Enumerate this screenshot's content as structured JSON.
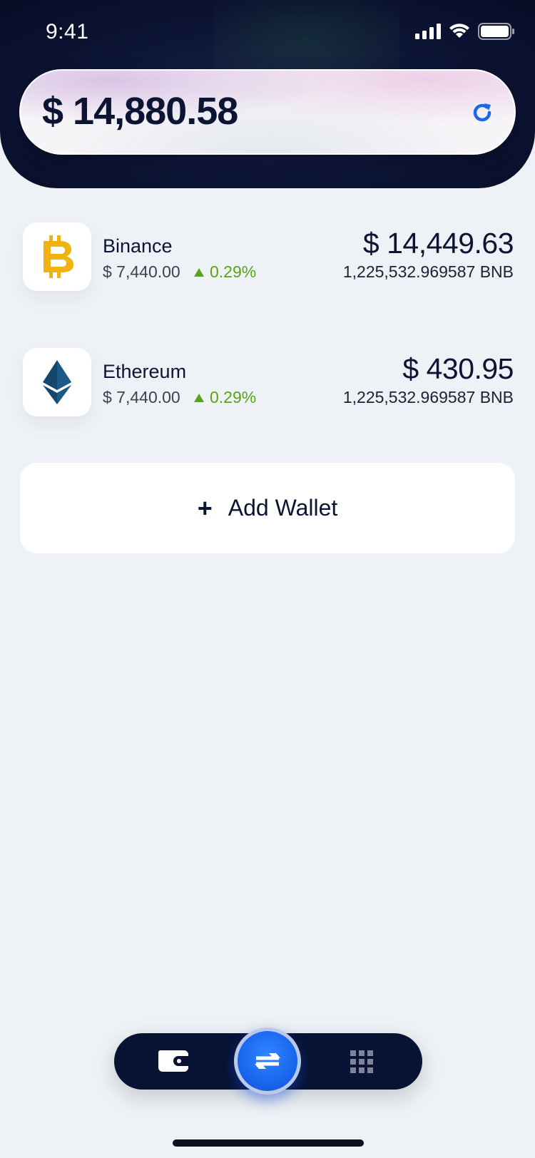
{
  "status_bar": {
    "time": "9:41"
  },
  "balance": {
    "total": "$ 14,880.58"
  },
  "wallets": [
    {
      "name": "Binance",
      "price": "$ 7,440.00",
      "change": "0.29%",
      "value": "$ 14,449.63",
      "quantity": "1,225,532.969587 BNB",
      "icon": "bitcoin-icon"
    },
    {
      "name": "Ethereum",
      "price": "$ 7,440.00",
      "change": "0.29%",
      "value": "$ 430.95",
      "quantity": "1,225,532.969587 BNB",
      "icon": "ethereum-icon"
    }
  ],
  "add_wallet": {
    "plus": "+",
    "label": "Add Wallet"
  },
  "nav": {
    "items": [
      "wallet-icon",
      "swap-icon",
      "grid-icon"
    ]
  },
  "colors": {
    "header_bg": "#0e1638",
    "accent_blue": "#1966ee",
    "positive": "#5aa319",
    "bitcoin": "#f1b312",
    "ethereum": "#14466e",
    "text_dark": "#0b1533"
  }
}
